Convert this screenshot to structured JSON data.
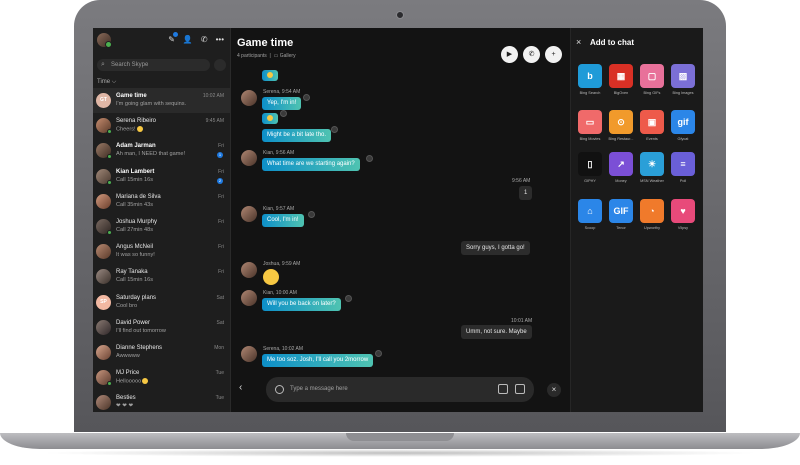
{
  "sidebar": {
    "search_placeholder": "Search Skype",
    "filter_label": "Time ⌵",
    "chats": [
      {
        "name": "Game time",
        "preview": "I'm going glam with sequins.",
        "time": "10:02 AM",
        "initials": "GT",
        "active": true,
        "bold": true
      },
      {
        "name": "Serena Ribeiro",
        "preview": "Cheers!",
        "time": "9:45 AM",
        "emoji": true
      },
      {
        "name": "Adam Jarman",
        "preview": "Ah man, I NEED that game!",
        "time": "Fri",
        "bold": true,
        "unread": true
      },
      {
        "name": "Kian Lambert",
        "preview": "Call 15min 16s",
        "time": "Fri",
        "bold": true,
        "unread": true
      },
      {
        "name": "Mariana de Silva",
        "preview": "Call 35min 43s",
        "time": "Fri"
      },
      {
        "name": "Joshua Murphy",
        "preview": "Call 27min 48s",
        "time": "Fri"
      },
      {
        "name": "Angus McNeil",
        "preview": "It was so funny!",
        "time": "Fri"
      },
      {
        "name": "Ray Tanaka",
        "preview": "Call 15min 16s",
        "time": "Fri"
      },
      {
        "name": "Saturday plans",
        "preview": "Cool bro",
        "time": "Sat",
        "initials": "SP"
      },
      {
        "name": "David Power",
        "preview": "I'll find out tomorrow",
        "time": "Sat"
      },
      {
        "name": "Dianne Stephens",
        "preview": "Awwwww",
        "time": "Mon"
      },
      {
        "name": "MJ Price",
        "preview": "Hellooooo",
        "time": "Tue",
        "emoji": true
      },
      {
        "name": "Besties",
        "preview": "❤ ❤ ❤",
        "time": "Tue"
      }
    ]
  },
  "chat": {
    "title": "Game time",
    "participants": "4 participants",
    "gallery": "Gallery",
    "messages": {
      "m1_meta": "Serena, 9:54 AM",
      "m1_text": "Yep, I'm in!",
      "m2_text": "Might be a bit late tho.",
      "m3_meta": "Kian, 9:56 AM",
      "m3_text": "What time are we starting again?",
      "m4_meta": "9:56 AM",
      "m4_text": "1",
      "m5_meta": "Kian, 9:57 AM",
      "m5_text": "Cool, I'm in!",
      "m6_text": "Sorry guys, I gotta go!",
      "m7_meta": "Joshua, 9:59 AM",
      "m8_meta": "Kian, 10:00 AM",
      "m8_text": "Will you be back on later?",
      "m9_meta": "10:01 AM",
      "m9_text": "Umm, not sure. Maybe",
      "m10_meta": "Serena, 10:02 AM",
      "m10_text": "Me too soz. Josh, I'll call you 2morrow"
    },
    "composer_placeholder": "Type a message here"
  },
  "panel": {
    "title": "Add to chat",
    "tiles": [
      {
        "label": "Bing Search",
        "color": "#1f9bd8",
        "glyph": "b"
      },
      {
        "label": "BigOven",
        "color": "#d93025",
        "glyph": "▦"
      },
      {
        "label": "Bing GIFs",
        "color": "#e8719a",
        "glyph": "▢"
      },
      {
        "label": "Bing Images",
        "color": "#7b6fd6",
        "glyph": "▨"
      },
      {
        "label": "Bing Movies",
        "color": "#f06a6a",
        "glyph": "▭"
      },
      {
        "label": "Bing Restaur...",
        "color": "#f19a2b",
        "glyph": "⊙"
      },
      {
        "label": "Events",
        "color": "#ee5a4a",
        "glyph": "▣"
      },
      {
        "label": "Gfycat",
        "color": "#2b86e8",
        "glyph": "gif"
      },
      {
        "label": "GIPHY",
        "color": "#111111",
        "glyph": "▯"
      },
      {
        "label": "Money",
        "color": "#7b4fd6",
        "glyph": "↗"
      },
      {
        "label": "MSN Weather",
        "color": "#2a9fd8",
        "glyph": "☀"
      },
      {
        "label": "Poll",
        "color": "#6a5fd8",
        "glyph": "≡"
      },
      {
        "label": "Scoop",
        "color": "#2b86e8",
        "glyph": "⌂"
      },
      {
        "label": "Tenor",
        "color": "#2b86e8",
        "glyph": "GIF"
      },
      {
        "label": "Upworthy",
        "color": "#f07a2b",
        "glyph": "◔"
      },
      {
        "label": "Vlipsy",
        "color": "#e84a7a",
        "glyph": "♥"
      }
    ]
  }
}
